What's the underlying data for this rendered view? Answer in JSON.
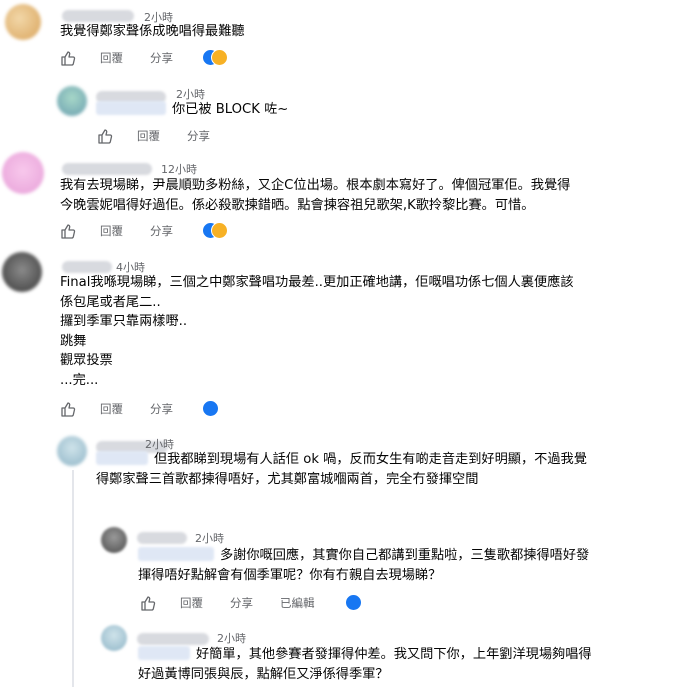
{
  "comments": [
    {
      "time": "2小時",
      "lines": [
        "我覺得鄭家聲係成晚唱得最難聽"
      ],
      "actions": {
        "like": "",
        "reply": "回覆",
        "share": "分享"
      },
      "reactions": [
        "like",
        "sad"
      ]
    },
    {
      "time": "2小時",
      "lines": [
        "你已被 BLOCK 咗~"
      ],
      "actions": {
        "like": "",
        "reply": "回覆",
        "share": "分享"
      },
      "reactions": []
    },
    {
      "time": "12小時",
      "lines": [
        "我有去現場睇，尹晨順勁多粉絲，又企C位出場。根本劇本寫好了。俾個冠軍佢。我覺得",
        "今晚雲妮唱得好過佢。係必殺歌揀錯晒。點會揀容祖兒歌架,K歌拎黎比賽。可惜。"
      ],
      "actions": {
        "like": "",
        "reply": "回覆",
        "share": "分享"
      },
      "reactions": [
        "like",
        "sad"
      ]
    },
    {
      "time": "4小時",
      "lines": [
        "Final我喺現場睇，三個之中鄭家聲唱功最差..更加正確地講，佢嘅唱功係七個人裏便應該",
        "係包尾或者尾二..",
        "攞到季軍只靠兩樣嘢..",
        "跳舞",
        "觀眾投票",
        "...完..."
      ],
      "actions": {
        "like": "",
        "reply": "回覆",
        "share": "分享"
      },
      "reactions": [
        "like"
      ]
    },
    {
      "time": "2小時",
      "lines": [
        "但我都睇到現場有人話佢 ok 喎，反而女生有啲走音走到好明顯，不過我覺",
        "得鄭家聲三首歌都揀得唔好，尤其鄭富城嗰兩首，完全冇發揮空間"
      ],
      "actions": {
        "like": "",
        "reply": "回覆",
        "share": "分享"
      },
      "reactions": []
    },
    {
      "time": "2小時",
      "lines": [
        "多謝你嘅回應，其實你自己都講到重點啦，三隻歌都揀得唔好發",
        "揮得唔好點解會有個季軍呢？你有冇親自去現場睇？"
      ],
      "actions": {
        "like": "",
        "reply": "回覆",
        "share": "分享",
        "edited": "已編輯"
      },
      "reactions": [
        "like"
      ]
    },
    {
      "time": "2小時",
      "lines": [
        "好簡單，其他參賽者發揮得仲差。我又問下你，上年劉洋現場夠唱得",
        "好過黃博同張與辰，點解佢又淨係得季軍？"
      ],
      "actions": {
        "like": "",
        "reply": "回覆",
        "share": "分享"
      },
      "reactions": []
    }
  ],
  "colors": {
    "accent": "#1877f2",
    "meta": "#65676b",
    "text": "#050505"
  }
}
